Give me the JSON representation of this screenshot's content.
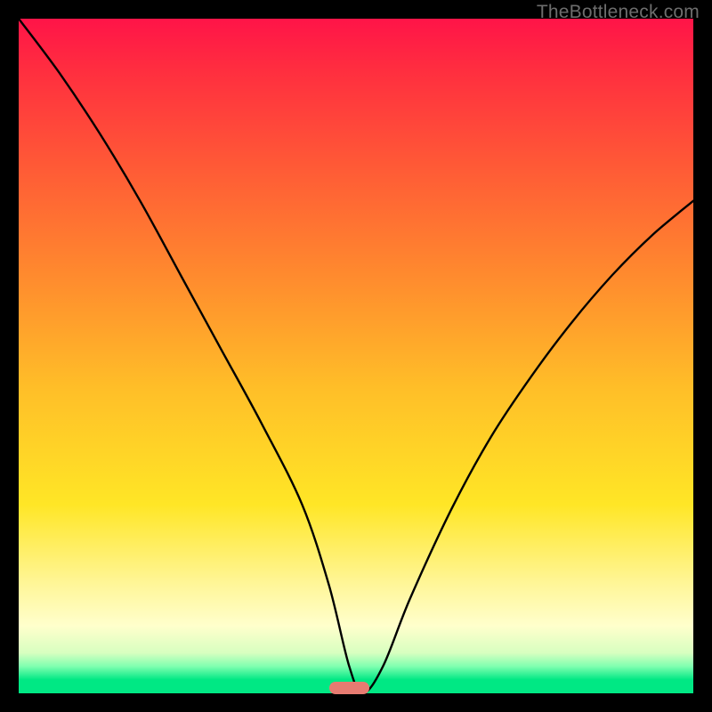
{
  "watermark": "TheBottleneck.com",
  "chart_data": {
    "type": "line",
    "title": "",
    "xlabel": "",
    "ylabel": "",
    "xlim": [
      0,
      100
    ],
    "ylim": [
      0,
      100
    ],
    "x": [
      0,
      6,
      12,
      18,
      24,
      30,
      36,
      42,
      46,
      49,
      51,
      54,
      58,
      64,
      70,
      76,
      82,
      88,
      94,
      100
    ],
    "values": [
      100,
      92,
      83,
      73,
      62,
      51,
      40,
      28,
      16,
      4,
      0,
      4,
      14,
      27,
      38,
      47,
      55,
      62,
      68,
      73
    ],
    "gradient_stops": [
      {
        "pos": 0.0,
        "color": "#ff1448"
      },
      {
        "pos": 0.22,
        "color": "#ff5a36"
      },
      {
        "pos": 0.55,
        "color": "#ffbf28"
      },
      {
        "pos": 0.84,
        "color": "#fff69a"
      },
      {
        "pos": 0.96,
        "color": "#80ffb0"
      },
      {
        "pos": 1.0,
        "color": "#00e884"
      }
    ],
    "minimum_marker": {
      "x_center": 49,
      "width_pct": 6,
      "color": "#e77b71"
    }
  }
}
